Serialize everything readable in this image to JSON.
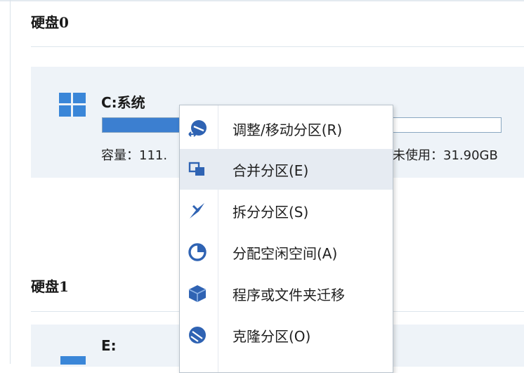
{
  "disks": [
    {
      "title": "硬盘0",
      "partition": {
        "name": "C:系统",
        "capacity_label": "容量：111.",
        "free_label": "未使用：31.90GB",
        "used_fraction": 0.72
      }
    },
    {
      "title": "硬盘1",
      "partition": {
        "name": "E:"
      }
    }
  ],
  "context_menu": {
    "items": [
      {
        "label": "调整/移动分区(R)",
        "icon": "resize-move-icon"
      },
      {
        "label": "合并分区(E)",
        "icon": "merge-icon"
      },
      {
        "label": "拆分分区(S)",
        "icon": "split-icon"
      },
      {
        "label": "分配空闲空间(A)",
        "icon": "allocate-space-icon"
      },
      {
        "label": "程序或文件夹迁移",
        "icon": "app-mover-icon"
      },
      {
        "label": "克隆分区(O)",
        "icon": "clone-icon"
      }
    ],
    "hovered_index": 1
  },
  "colors": {
    "accent": "#3c7fd0",
    "icon_blue": "#2f63b3",
    "row_bg": "#eef3f8",
    "hover_bg": "#e6ebf2"
  }
}
